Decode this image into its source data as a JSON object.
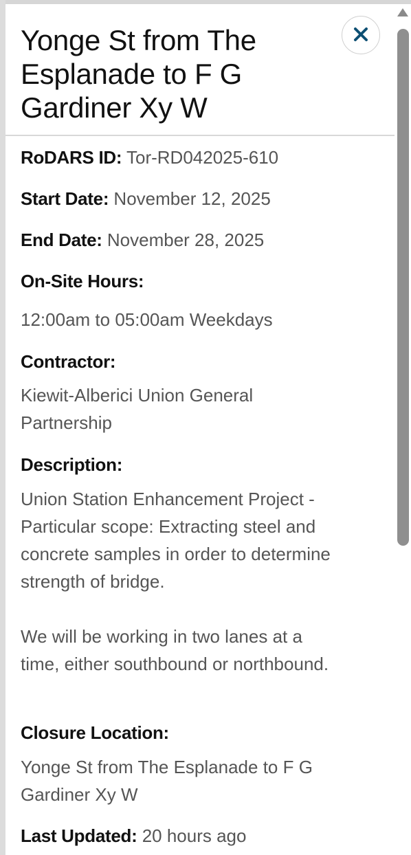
{
  "panel": {
    "title": "Yonge St from The Esplanade to F G Gardiner Xy W",
    "close_icon": "close-icon"
  },
  "details": {
    "rodars_id_label": "RoDARS ID:",
    "rodars_id_value": "Tor-RD042025-610",
    "start_date_label": "Start Date:",
    "start_date_value": "November 12, 2025",
    "end_date_label": "End Date:",
    "end_date_value": "November 28, 2025",
    "onsite_hours_label": "On-Site Hours:",
    "onsite_hours_value": "12:00am to 05:00am Weekdays",
    "contractor_label": "Contractor:",
    "contractor_value": "Kiewit-Alberici Union General Partnership",
    "description_label": "Description:",
    "description_para1": "Union Station Enhancement Project - Particular scope: Extracting steel and concrete samples in order to determine strength of bridge.",
    "description_para2": "We will be working in two lanes at a time, either southbound or northbound.",
    "closure_location_label": "Closure Location:",
    "closure_location_value": "Yonge St from The Esplanade to F G Gardiner Xy W",
    "last_updated_label": "Last Updated:",
    "last_updated_value": "20 hours ago"
  },
  "colors": {
    "close_icon": "#0d4f73",
    "label": "#111111",
    "value": "#555555",
    "scrollbar": "#8f8f8f"
  }
}
